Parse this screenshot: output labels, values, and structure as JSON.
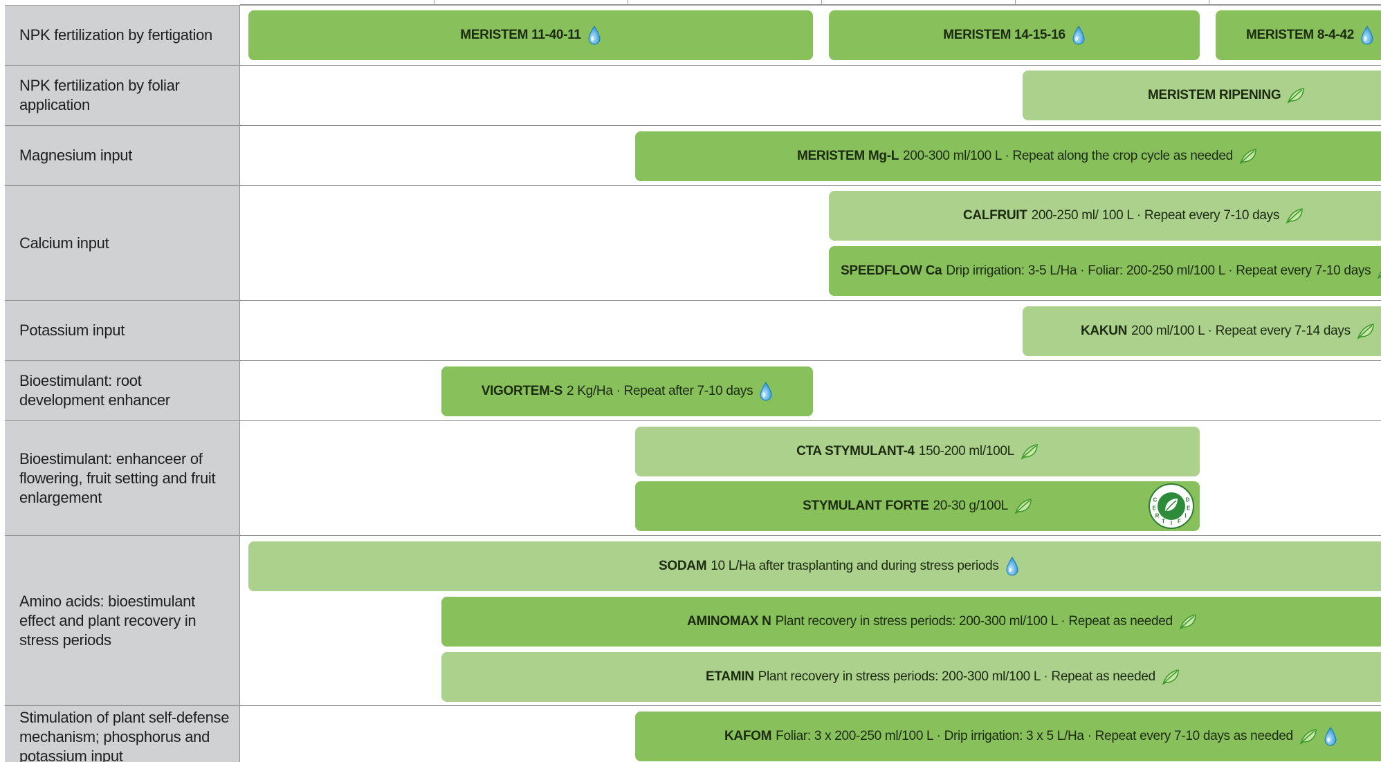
{
  "rows": [
    {
      "label": "NPK fertilization by fertigation"
    },
    {
      "label": "NPK fertilization by foliar application"
    },
    {
      "label": "Magnesium input"
    },
    {
      "label": "Calcium input"
    },
    {
      "label": "Potassium input"
    },
    {
      "label": "Bioestimulant: root development enhancer"
    },
    {
      "label": "Bioestimulant: enhanceer of flowering, fruit setting and fruit enlargement"
    },
    {
      "label": "Amino acids: bioestimulant effect and plant recovery in stress periods"
    },
    {
      "label": "Stimulation of plant self-defense mechanism; phosphorus and potassium input"
    }
  ],
  "bars": [
    {
      "name": "MERISTEM 11-40-11",
      "desc": "",
      "icons": [
        "drop-icon"
      ]
    },
    {
      "name": "MERISTEM 14-15-16",
      "desc": "",
      "icons": [
        "drop-icon"
      ]
    },
    {
      "name": "MERISTEM 8-4-42",
      "desc": "",
      "icons": [
        "drop-icon"
      ]
    },
    {
      "name": "MERISTEM RIPENING",
      "desc": "",
      "icons": [
        "leaf-icon"
      ]
    },
    {
      "name": "MERISTEM Mg-L",
      "desc": "200-300 ml/100 L · Repeat along the crop cycle as needed",
      "icons": [
        "leaf-icon"
      ]
    },
    {
      "name": "CALFRUIT",
      "desc": "200-250 ml/ 100 L · Repeat every 7-10 days",
      "icons": [
        "leaf-icon"
      ]
    },
    {
      "name": "SPEEDFLOW Ca",
      "desc": "Drip irrigation: 3-5 L/Ha · Foliar: 200-250 ml/100 L · Repeat every 7-10 days",
      "icons": [
        "leaf-icon",
        "drop-icon"
      ]
    },
    {
      "name": "KAKUN",
      "desc": "200 ml/100 L · Repeat every 7-14 days",
      "icons": [
        "leaf-icon"
      ]
    },
    {
      "name": "VIGORTEM-S",
      "desc": "2 Kg/Ha · Repeat after 7-10 days",
      "icons": [
        "drop-icon"
      ]
    },
    {
      "name": "CTA STYMULANT-4",
      "desc": "150-200 ml/100L",
      "icons": [
        "leaf-icon"
      ]
    },
    {
      "name": "STYMULANT FORTE",
      "desc": "20-30 g/100L",
      "icons": [
        "leaf-icon"
      ],
      "certified": true
    },
    {
      "name": "SODAM",
      "desc": "10 L/Ha after trasplanting and during stress periods",
      "icons": [
        "drop-icon"
      ]
    },
    {
      "name": "AMINOMAX N",
      "desc": "Plant recovery in stress periods: 200-300 ml/100 L · Repeat as needed",
      "icons": [
        "leaf-icon"
      ]
    },
    {
      "name": "ETAMIN",
      "desc": "Plant recovery in stress periods: 200-300 ml/100 L · Repeat as needed",
      "icons": [
        "leaf-icon"
      ],
      "certified": true
    },
    {
      "name": "KAFOM",
      "desc": "Foliar: 3 x 200-250 ml/100 L · Drip irrigation: 3 x 5 L/Ha · Repeat every 7-10 days as needed",
      "icons": [
        "leaf-icon",
        "drop-icon"
      ]
    }
  ],
  "badge": {
    "text": "CERTIFIED"
  },
  "colors": {
    "bar_dark": "#88c05b",
    "bar_light": "#abd18c",
    "label_bg": "#d0d1d3",
    "drop": "#2e9ad8",
    "leaf": "#3f9a2e"
  }
}
